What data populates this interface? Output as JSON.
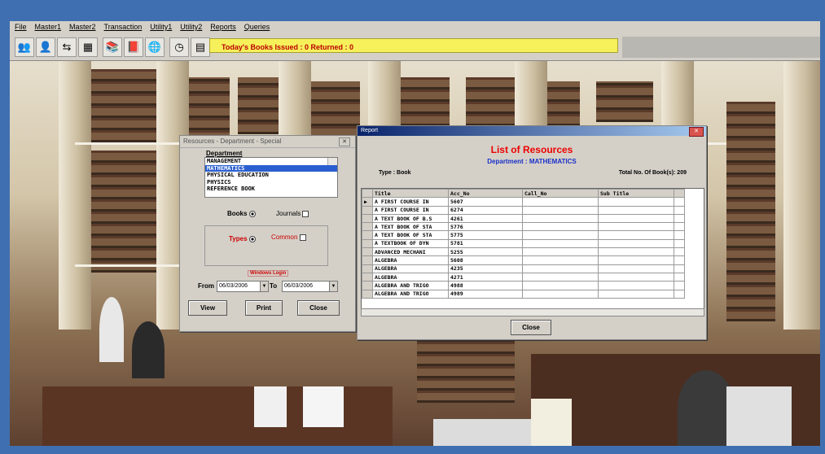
{
  "menu": [
    "File",
    "Master1",
    "Master2",
    "Transaction",
    "Utility1",
    "Utility2",
    "Reports",
    "Queries"
  ],
  "toolbar": {
    "icons": [
      "users-icon",
      "users-edit-icon",
      "arrows-icon",
      "calculator-icon",
      "books-icon",
      "book-icon",
      "globe-icon",
      "clock-icon",
      "calendar-icon"
    ],
    "status_text": "Today's Books Issued : 0 Returned : 0"
  },
  "dialog1": {
    "title": "Resources - Department - Special",
    "department_label": "Department",
    "departments": [
      "MANAGEMENT",
      "MATHEMATICS",
      "PHYSICAL EDUCATION",
      "PHYSICS",
      "REFERENCE BOOK"
    ],
    "selected_department": "MATHEMATICS",
    "books_label": "Books",
    "journals_label": "Journals",
    "types_label": "Types",
    "common_label": "Common",
    "warning_text": "Windows Login",
    "from_label": "From",
    "from_date": "06/03/2006",
    "to_label": "To",
    "to_date": "06/03/2006",
    "view_label": "View",
    "print_label": "Print",
    "close_label": "Close"
  },
  "report": {
    "window_title": "Report",
    "title": "List of Resources",
    "department_line": "Department : MATHEMATICS",
    "type_line": "Type : Book",
    "total_line": "Total No. Of Book(s): 209",
    "columns": [
      "Title",
      "Acc_No",
      "Call_No",
      "Sub Title"
    ],
    "rows": [
      [
        "A FIRST COURSE IN",
        "5607",
        "",
        ""
      ],
      [
        "A FIRST COURSE IN",
        "6274",
        "",
        ""
      ],
      [
        "A TEXT BOOK OF B.S",
        "4261",
        "",
        ""
      ],
      [
        "A TEXT BOOK OF STA",
        "5776",
        "",
        ""
      ],
      [
        "A TEXT BOOK OF STA",
        "5775",
        "",
        ""
      ],
      [
        "A TEXTBOOK OF DYN",
        "5781",
        "",
        ""
      ],
      [
        "ADVANCED MECHANI",
        "5255",
        "",
        ""
      ],
      [
        "ALGEBRA",
        "5608",
        "",
        ""
      ],
      [
        "ALGEBRA",
        "4235",
        "",
        ""
      ],
      [
        "ALGEBRA",
        "4271",
        "",
        ""
      ],
      [
        "ALGEBRA AND TRIGO",
        "4988",
        "",
        ""
      ],
      [
        "ALGEBRA AND TRIGO",
        "4989",
        "",
        ""
      ]
    ],
    "close_label": "Close"
  }
}
